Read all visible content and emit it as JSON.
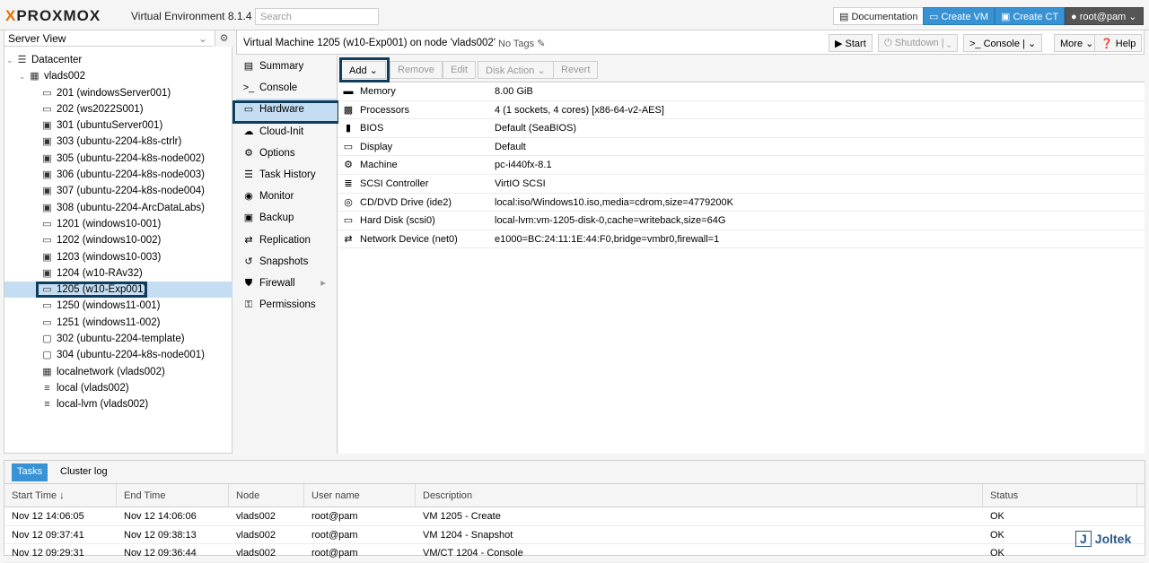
{
  "topbar": {
    "logo": "PROXMOX",
    "version": "Virtual Environment 8.1.4",
    "search_placeholder": "Search",
    "documentation": "Documentation",
    "create_vm": "Create VM",
    "create_ct": "Create CT",
    "user": "root@pam"
  },
  "left": {
    "view": "Server View",
    "tree": [
      {
        "label": "Datacenter",
        "icon": "datacenter-icon"
      },
      {
        "label": "vlads002",
        "icon": "node-icon"
      },
      {
        "label": "201 (windowsServer001)",
        "icon": "vm-stopped-icon"
      },
      {
        "label": "202 (ws2022S001)",
        "icon": "vm-stopped-icon"
      },
      {
        "label": "301 (ubuntuServer001)",
        "icon": "vm-running-icon"
      },
      {
        "label": "303 (ubuntu-2204-k8s-ctrlr)",
        "icon": "vm-running-icon"
      },
      {
        "label": "305 (ubuntu-2204-k8s-node002)",
        "icon": "vm-running-icon"
      },
      {
        "label": "306 (ubuntu-2204-k8s-node003)",
        "icon": "vm-running-icon"
      },
      {
        "label": "307 (ubuntu-2204-k8s-node004)",
        "icon": "vm-running-icon"
      },
      {
        "label": "308 (ubuntu-2204-ArcDataLabs)",
        "icon": "vm-running-icon"
      },
      {
        "label": "1201 (windows10-001)",
        "icon": "vm-stopped-icon"
      },
      {
        "label": "1202 (windows10-002)",
        "icon": "vm-stopped-icon"
      },
      {
        "label": "1203 (windows10-003)",
        "icon": "vm-running-icon"
      },
      {
        "label": "1204 (w10-RAv32)",
        "icon": "vm-running-icon"
      },
      {
        "label": "1205 (w10-Exp001)",
        "icon": "vm-stopped-icon"
      },
      {
        "label": "1250 (windows11-001)",
        "icon": "vm-stopped-icon"
      },
      {
        "label": "1251 (windows11-002)",
        "icon": "vm-stopped-icon"
      },
      {
        "label": "302 (ubuntu-2204-template)",
        "icon": "template-icon"
      },
      {
        "label": "304 (ubuntu-2204-k8s-node001)",
        "icon": "template-icon"
      },
      {
        "label": "localnetwork (vlads002)",
        "icon": "network-icon"
      },
      {
        "label": "local (vlads002)",
        "icon": "storage-icon"
      },
      {
        "label": "local-lvm (vlads002)",
        "icon": "storage-icon"
      }
    ]
  },
  "header": {
    "title": "Virtual Machine 1205 (w10-Exp001) on node 'vlads002'",
    "tags": "No Tags",
    "start": "Start",
    "shutdown": "Shutdown",
    "console": "Console",
    "more": "More",
    "help": "Help"
  },
  "nav": [
    {
      "label": "Summary",
      "icon": "book-icon"
    },
    {
      "label": "Console",
      "icon": "terminal-icon"
    },
    {
      "label": "Hardware",
      "icon": "monitor-icon"
    },
    {
      "label": "Cloud-Init",
      "icon": "cloud-icon"
    },
    {
      "label": "Options",
      "icon": "gear-icon"
    },
    {
      "label": "Task History",
      "icon": "list-icon"
    },
    {
      "label": "Monitor",
      "icon": "eye-icon"
    },
    {
      "label": "Backup",
      "icon": "floppy-icon"
    },
    {
      "label": "Replication",
      "icon": "retweet-icon"
    },
    {
      "label": "Snapshots",
      "icon": "history-icon"
    },
    {
      "label": "Firewall",
      "icon": "shield-icon"
    },
    {
      "label": "Permissions",
      "icon": "unlock-icon"
    }
  ],
  "toolbar": {
    "add": "Add",
    "remove": "Remove",
    "edit": "Edit",
    "disk_action": "Disk Action",
    "revert": "Revert"
  },
  "hardware": [
    {
      "icon": "memory-icon",
      "name": "Memory",
      "value": "8.00 GiB"
    },
    {
      "icon": "cpu-icon",
      "name": "Processors",
      "value": "4 (1 sockets, 4 cores) [x86-64-v2-AES]"
    },
    {
      "icon": "microchip-icon",
      "name": "BIOS",
      "value": "Default (SeaBIOS)"
    },
    {
      "icon": "display-icon",
      "name": "Display",
      "value": "Default"
    },
    {
      "icon": "cogs-icon",
      "name": "Machine",
      "value": "pc-i440fx-8.1"
    },
    {
      "icon": "database-icon",
      "name": "SCSI Controller",
      "value": "VirtIO SCSI"
    },
    {
      "icon": "cdrom-icon",
      "name": "CD/DVD Drive (ide2)",
      "value": "local:iso/Windows10.iso,media=cdrom,size=4779200K"
    },
    {
      "icon": "harddisk-icon",
      "name": "Hard Disk (scsi0)",
      "value": "local-lvm:vm-1205-disk-0,cache=writeback,size=64G"
    },
    {
      "icon": "exchange-icon",
      "name": "Network Device (net0)",
      "value": "e1000=BC:24:11:1E:44:F0,bridge=vmbr0,firewall=1"
    }
  ],
  "bottom": {
    "tabs": [
      "Tasks",
      "Cluster log"
    ],
    "columns": [
      "Start Time",
      "End Time",
      "Node",
      "User name",
      "Description",
      "Status"
    ],
    "rows": [
      [
        "Nov 12 14:06:05",
        "Nov 12 14:06:06",
        "vlads002",
        "root@pam",
        "VM 1205 - Create",
        "OK"
      ],
      [
        "Nov 12 09:37:41",
        "Nov 12 09:38:13",
        "vlads002",
        "root@pam",
        "VM 1204 - Snapshot",
        "OK"
      ],
      [
        "Nov 12 09:29:31",
        "Nov 12 09:36:44",
        "vlads002",
        "root@pam",
        "VM/CT 1204 - Console",
        "OK"
      ]
    ]
  },
  "watermark": "Joltek"
}
